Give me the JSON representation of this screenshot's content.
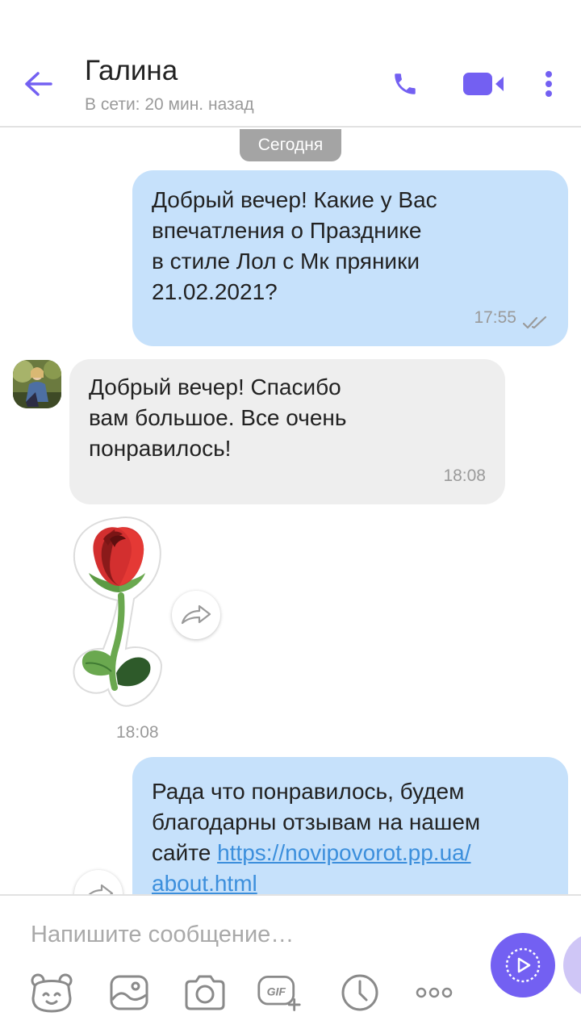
{
  "header": {
    "contact_name": "Галина",
    "status": "В сети: 20 мин. назад"
  },
  "chat": {
    "date_label": "Сегодня",
    "messages": [
      {
        "direction": "outgoing",
        "text": "Добрый вечер!  Какие у Вас\nвпечатления о Празднике\nв стиле Лол с Мк пряники\n21.02.2021?",
        "time": "17:55",
        "status": "read"
      },
      {
        "direction": "incoming",
        "text": "Добрый вечер! Спасибо\nвам  большое.  Все очень\nпонравилось!",
        "time": "18:08"
      },
      {
        "direction": "incoming",
        "type": "sticker",
        "sticker": "red-rose",
        "time": "18:08"
      },
      {
        "direction": "outgoing",
        "text_before_link": "Рада что понравилось, будем\nблагодарны отзывам на нашем\nсайте ",
        "link": "https://novipovorot.pp.ua/\nabout.html"
      }
    ]
  },
  "composer": {
    "placeholder": "Напишите сообщение…",
    "tools": [
      "sticker-icon",
      "gallery-icon",
      "camera-icon",
      "gif-icon",
      "timer-icon",
      "more-icon"
    ]
  },
  "colors": {
    "accent": "#7360f2",
    "outgoing_bubble": "#c6e1fb",
    "incoming_bubble": "#eeeeee",
    "link": "#3c8fdc"
  }
}
